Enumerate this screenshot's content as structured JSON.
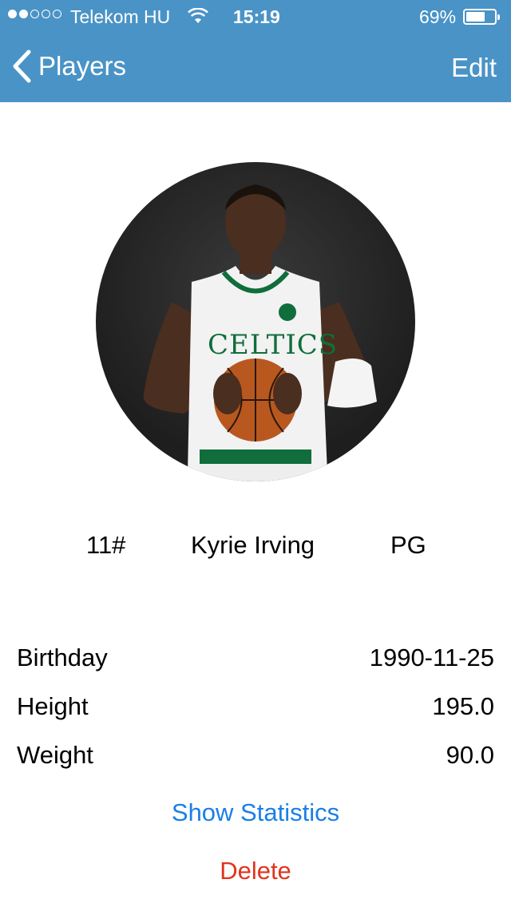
{
  "status_bar": {
    "carrier": "Telekom HU",
    "time": "15:19",
    "battery_percent_text": "69%",
    "battery_level": 0.69,
    "signal_bars_filled": 2,
    "signal_bars_total": 5
  },
  "nav": {
    "back_label": "Players",
    "edit_label": "Edit"
  },
  "player": {
    "number": "11#",
    "name": "Kyrie Irving",
    "position": "PG"
  },
  "details": [
    {
      "label": "Birthday",
      "value": "1990-11-25"
    },
    {
      "label": "Height",
      "value": "195.0"
    },
    {
      "label": "Weight",
      "value": "90.0"
    }
  ],
  "actions": {
    "show_statistics": "Show Statistics",
    "delete": "Delete"
  },
  "colors": {
    "nav_bar": "#4a93c6",
    "link_blue": "#1a7fe6",
    "destructive_red": "#e2341d"
  }
}
